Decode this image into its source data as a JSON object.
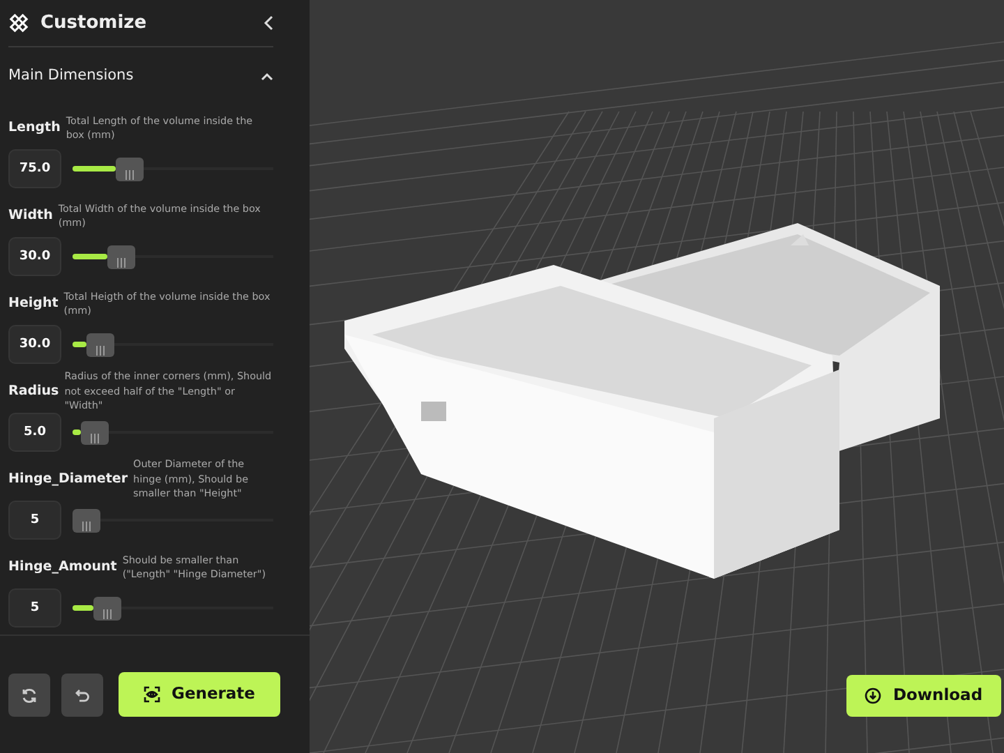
{
  "sidebar": {
    "title": "Customize",
    "section": {
      "title": "Main Dimensions",
      "expanded": true
    },
    "parameters": [
      {
        "name": "Length",
        "description": "Total Length of the volume inside the box (mm)",
        "value": "75.0",
        "level": 0.25
      },
      {
        "name": "Width",
        "description": "Total Width of the volume inside the box (mm)",
        "value": "30.0",
        "level": 0.2
      },
      {
        "name": "Height",
        "description": "Total Heigth of the volume inside the box (mm)",
        "value": "30.0",
        "level": 0.08
      },
      {
        "name": "Radius",
        "description": "Radius of the inner corners (mm), Should not exceed half of the \"Length\" or \"Width\"",
        "value": "5.0",
        "level": 0.05
      },
      {
        "name": "Hinge_Diameter",
        "description": "Outer Diameter of the hinge (mm), Should be smaller than \"Height\"",
        "value": "5",
        "level": 0.0
      },
      {
        "name": "Hinge_Amount",
        "description": "Should be smaller than (\"Length\" \"Hinge Diameter\")",
        "value": "5",
        "level": 0.12
      }
    ],
    "generate_button": "Generate"
  },
  "viewport": {
    "download_button": "Download"
  }
}
